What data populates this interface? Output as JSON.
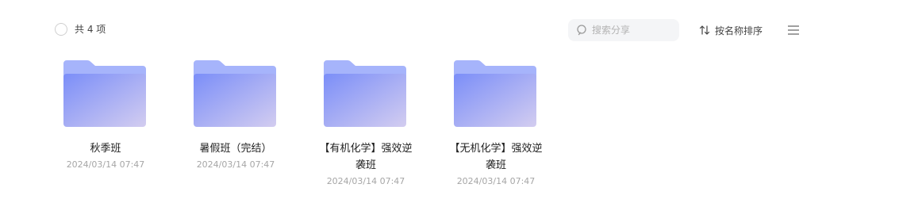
{
  "toolbar": {
    "count_text": "共 4 项",
    "search_placeholder": "搜索分享",
    "sort_label": "按名称排序"
  },
  "icons": {
    "search": "search-icon",
    "sort": "sort-arrows-icon",
    "view": "list-view-icon",
    "folder": "folder-icon"
  },
  "colors": {
    "folder_back": "#a6b4fb",
    "folder_front_start": "#7b8ef8",
    "folder_front_end": "#d3cdf0"
  },
  "folders": [
    {
      "name": "秋季班",
      "date": "2024/03/14 07:47"
    },
    {
      "name": "暑假班（完结）",
      "date": "2024/03/14 07:47"
    },
    {
      "name": "【有机化学】强效逆袭班",
      "date": "2024/03/14 07:47"
    },
    {
      "name": "【无机化学】强效逆袭班",
      "date": "2024/03/14 07:47"
    }
  ]
}
